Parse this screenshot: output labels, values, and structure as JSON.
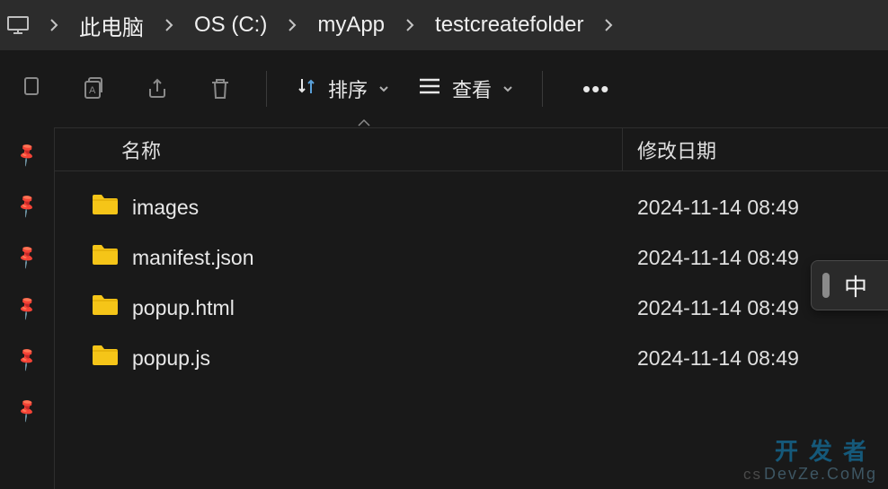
{
  "breadcrumb": {
    "items": [
      "此电脑",
      "OS (C:)",
      "myApp",
      "testcreatefolder"
    ]
  },
  "toolbar": {
    "sort_label": "排序",
    "view_label": "查看"
  },
  "columns": {
    "name": "名称",
    "modified": "修改日期"
  },
  "files": [
    {
      "name": "images",
      "modified": "2024-11-14 08:49"
    },
    {
      "name": "manifest.json",
      "modified": "2024-11-14 08:49"
    },
    {
      "name": "popup.html",
      "modified": "2024-11-14 08:49"
    },
    {
      "name": "popup.js",
      "modified": "2024-11-14 08:49"
    }
  ],
  "ime": {
    "mode": "中"
  },
  "watermark": {
    "line1": "开发者",
    "line2": "DevZe.CoMg",
    "prefix": "cs"
  }
}
